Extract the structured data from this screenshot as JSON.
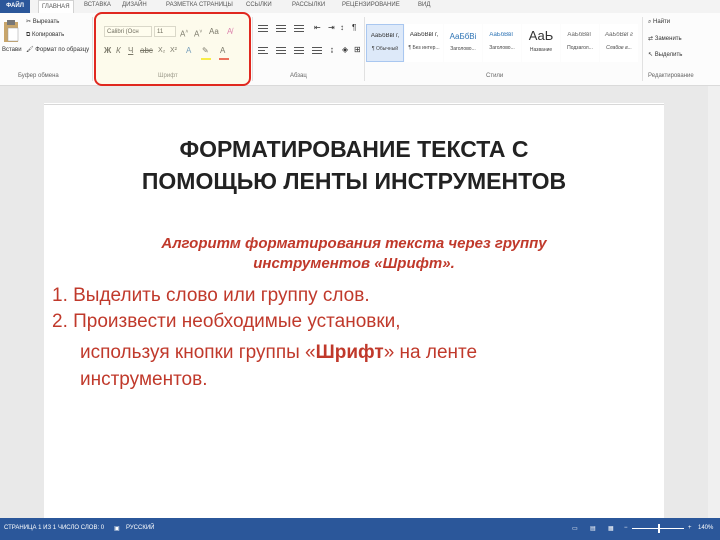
{
  "tabs": [
    "ФАЙЛ",
    "ГЛАВНАЯ",
    "ВСТАВКА",
    "ДИЗАЙН",
    "РАЗМЕТКА СТРАНИЦЫ",
    "ССЫЛКИ",
    "РАССЫЛКИ",
    "РЕЦЕНЗИРОВАНИЕ",
    "ВИД"
  ],
  "clipboard": {
    "paste": "Встави",
    "cut": "Вырезать",
    "copy": "Копировать",
    "format_painter": "Формат по образцу",
    "group": "Буфер обмена"
  },
  "font": {
    "name": "Calibri (Осн",
    "size": "11",
    "group": "Шрифт"
  },
  "paragraph": {
    "group": "Абзац"
  },
  "styles": {
    "group": "Стили",
    "items": [
      {
        "sample": "АаБбВвГг,",
        "name": "¶ Обычный"
      },
      {
        "sample": "АаБбВвГг,",
        "name": "¶ Без интер..."
      },
      {
        "sample": "АаБбВі",
        "name": "Заголово..."
      },
      {
        "sample": "АаБбВвГ",
        "name": "Заголово..."
      },
      {
        "sample": "АаЬ",
        "name": "Название"
      },
      {
        "sample": "АаБбВвГ",
        "name": "Подзагол..."
      },
      {
        "sample": "АаБбВвГг",
        "name": "Слабое в..."
      }
    ]
  },
  "editing": {
    "find": "Найти",
    "replace": "Заменить",
    "select": "Выделить",
    "group": "Редактирование"
  },
  "document": {
    "title_line1": "ФОРМАТИРОВАНИЕ ТЕКСТА С",
    "title_line2": "ПОМОЩЬЮ ЛЕНТЫ ИНСТРУМЕНТОВ",
    "subtitle_line1": "Алгоритм форматирования текста через группу",
    "subtitle_line2": "инструментов «Шрифт».",
    "step1": "1. Выделить слово или группу слов.",
    "step2_line1": "2. Произвести необходимые установки,",
    "step2_line2_pre": "используя кнопки группы «",
    "step2_line2_bold": "Шрифт",
    "step2_line2_post": "» на ленте",
    "step2_line3": "инструментов."
  },
  "status": {
    "page": "СТРАНИЦА 1 ИЗ 1",
    "words": "ЧИСЛО СЛОВ: 0",
    "language": "РУССКИЙ",
    "zoom": "140%"
  },
  "colors": {
    "accent": "#2b579a",
    "text_red": "#c0392b",
    "highlight_border": "#e0281f"
  }
}
